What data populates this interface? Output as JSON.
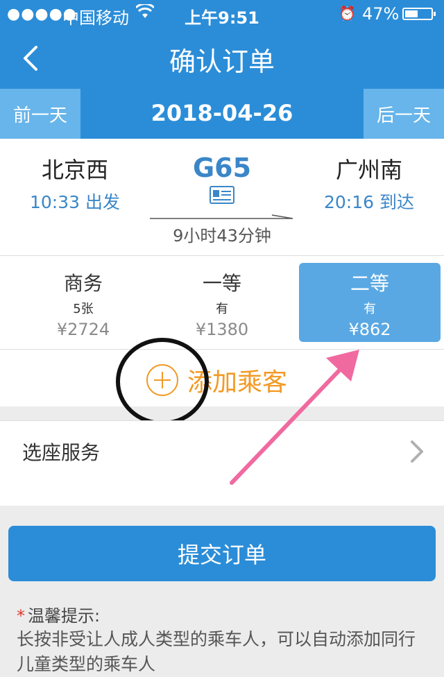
{
  "status_bar": {
    "signal": "●●●●●",
    "carrier": "中国移动",
    "time": "上午9:51",
    "battery": "47%"
  },
  "nav": {
    "title": "确认订单"
  },
  "date_bar": {
    "prev_label": "前一天",
    "date": "2018-04-26",
    "next_label": "后一天"
  },
  "train": {
    "from_station": "北京西",
    "from_time": "10:33 出发",
    "number": "G65",
    "to_station": "广州南",
    "to_time": "20:16 到达",
    "duration": "9小时43分钟"
  },
  "seats": [
    {
      "class": "商务",
      "count": "5张",
      "price": "¥2724",
      "selected": false
    },
    {
      "class": "一等",
      "count": "有",
      "price": "¥1380",
      "selected": false
    },
    {
      "class": "二等",
      "count": "有",
      "price": "¥862",
      "selected": true
    }
  ],
  "add_passenger": {
    "label": "添加乘客"
  },
  "seat_service": {
    "label": "选座服务"
  },
  "submit": {
    "label": "提交订单"
  },
  "tips": {
    "star": "*",
    "title": "温馨提示:",
    "body": "长按非受让人成人类型的乘车人，可以自动添加同行儿童类型的乘车人"
  },
  "colors": {
    "primary": "#2b8dd8",
    "selected_seat": "#5aa8e3",
    "accent_orange": "#f29a25",
    "annotation_pink": "#f06aa0"
  }
}
